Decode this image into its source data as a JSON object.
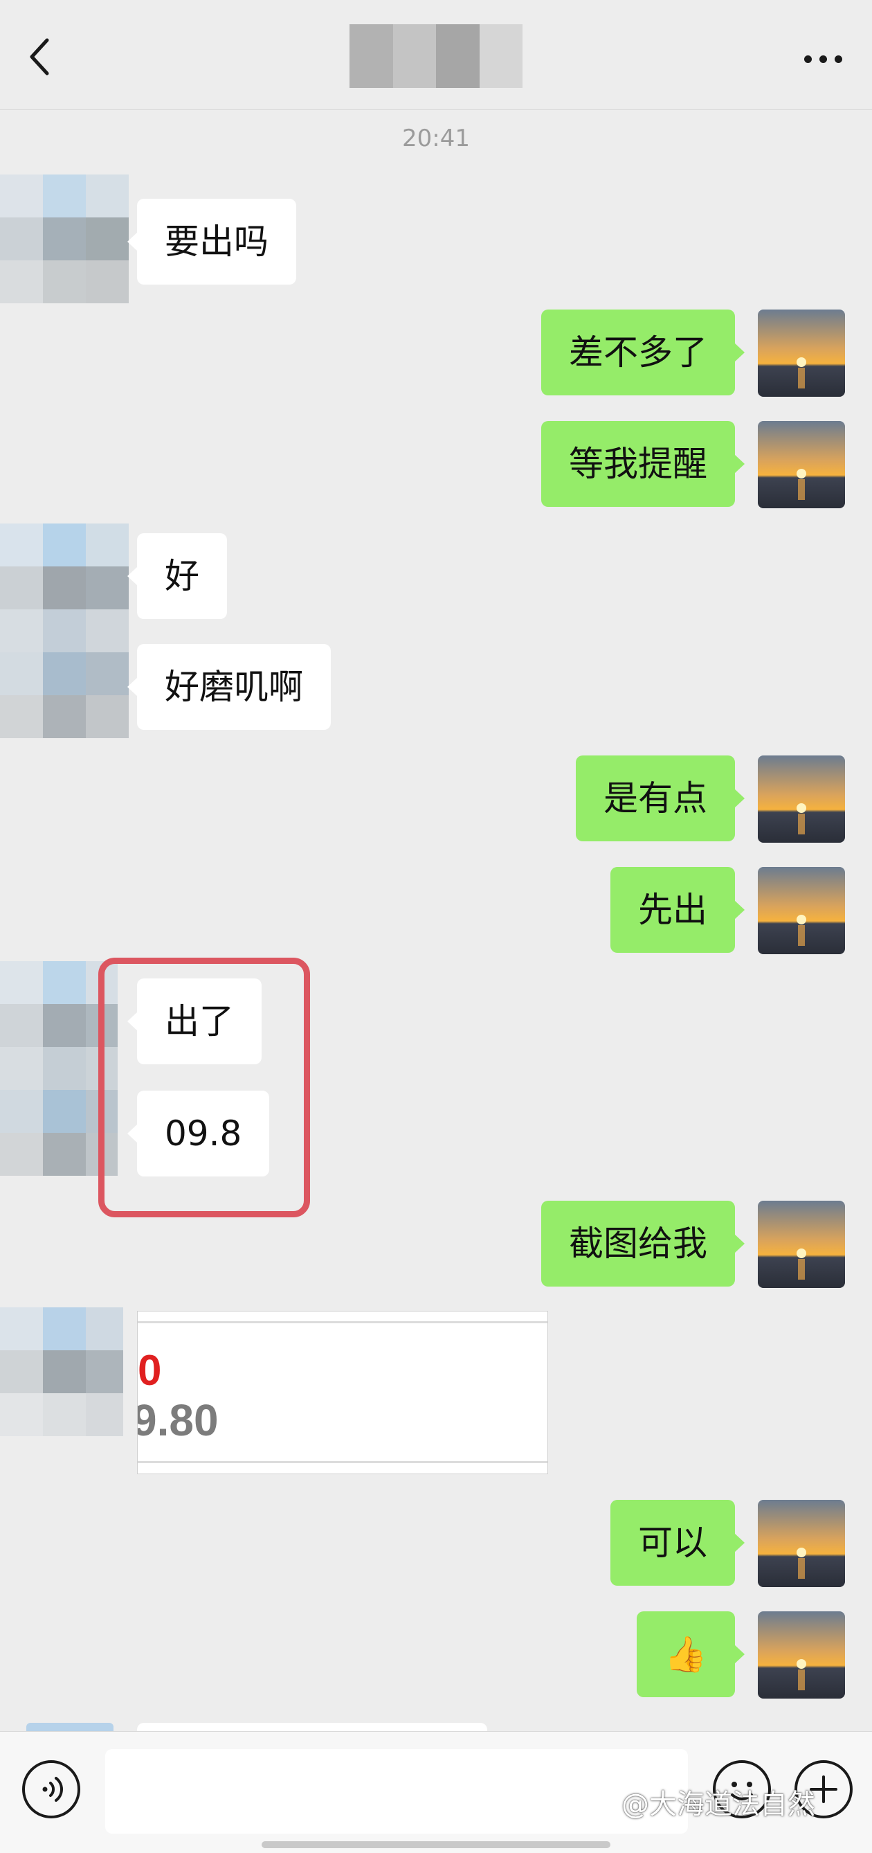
{
  "header": {
    "title": "",
    "back_icon": "chevron-left-icon",
    "more_icon": "more-dots-icon"
  },
  "time_label": "20:41",
  "messages": [
    {
      "sender": "peer",
      "text": "要出吗"
    },
    {
      "sender": "me",
      "text": "差不多了"
    },
    {
      "sender": "me",
      "text": "等我提醒"
    },
    {
      "sender": "peer",
      "text": "好"
    },
    {
      "sender": "peer",
      "text": "好磨叽啊"
    },
    {
      "sender": "me",
      "text": "是有点"
    },
    {
      "sender": "me",
      "text": "先出"
    },
    {
      "sender": "peer",
      "text": "出了"
    },
    {
      "sender": "peer",
      "text": "09.8"
    },
    {
      "sender": "me",
      "text": "截图给我"
    },
    {
      "sender": "peer",
      "type": "image",
      "red_text": "0",
      "gray_text": "9.80"
    },
    {
      "sender": "me",
      "text": "可以"
    },
    {
      "sender": "me",
      "text": "👍"
    }
  ],
  "input_bar": {
    "voice_icon": "voice-icon",
    "emoji_icon": "emoji-icon",
    "plus_icon": "plus-icon",
    "input_value": ""
  },
  "watermark": "@大海道法自然",
  "colors": {
    "background": "#ededed",
    "my_bubble": "#95ec69",
    "peer_bubble": "#ffffff",
    "highlight": "#dc5660"
  }
}
